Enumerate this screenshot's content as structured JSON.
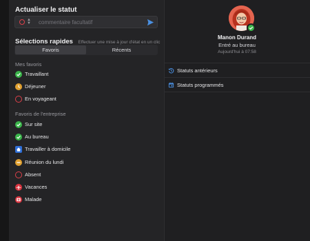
{
  "update_status": {
    "title": "Actualiser le statut",
    "comment_placeholder": "commentaire facultatif"
  },
  "quick": {
    "title": "Sélections rapides",
    "hint": "Effectuer une mise à jour d'état en un clic",
    "tabs": [
      "Favoris",
      "Récents"
    ],
    "active_tab": "Favoris"
  },
  "my_favorites": {
    "label": "Mes favoris",
    "items": [
      {
        "label": "Travaillant",
        "icon": "check-circle-icon"
      },
      {
        "label": "Déjeuner",
        "icon": "clock-icon"
      },
      {
        "label": "En voyageant",
        "icon": "red-ring-icon"
      }
    ]
  },
  "company_favorites": {
    "label": "Favoris de l'entreprise",
    "items": [
      {
        "label": "Sur site",
        "icon": "check-circle-icon"
      },
      {
        "label": "Au bureau",
        "icon": "check-circle-icon"
      },
      {
        "label": "Travailler à domicile",
        "icon": "home-icon"
      },
      {
        "label": "Réunion du lundi",
        "icon": "minus-circle-icon"
      },
      {
        "label": "Absent",
        "icon": "red-ring-icon"
      },
      {
        "label": "Vacances",
        "icon": "airplane-icon"
      },
      {
        "label": "Malade",
        "icon": "medical-icon"
      }
    ]
  },
  "profile": {
    "name": "Manon Durand",
    "status": "Entré au bureau",
    "time": "Aujourd'hui à 07:58"
  },
  "links": {
    "previous": "Statuts antérieurs",
    "scheduled": "Statuts programmés"
  },
  "colors": {
    "accent": "#4a90e2",
    "available": "#3ab54a",
    "away": "#e0a030",
    "busy": "#e0414b"
  }
}
